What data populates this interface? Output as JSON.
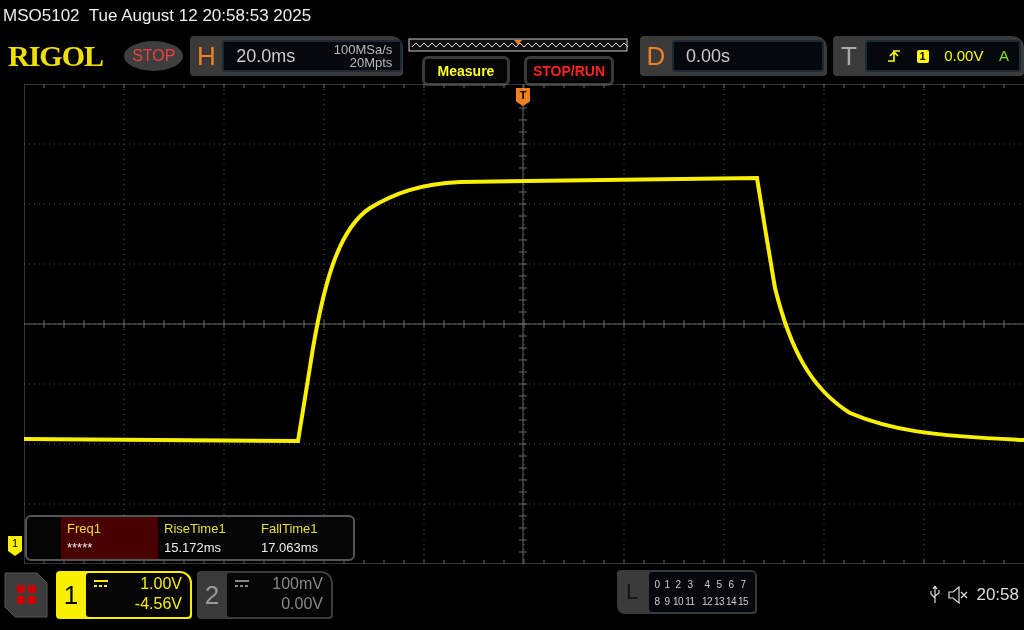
{
  "status_bar": {
    "title": "MSO5102  Tue August 12 20:58:53 2025"
  },
  "toolbar": {
    "logo": "RIGOL",
    "run_state": "STOP",
    "horizontal": {
      "label": "H",
      "timebase": "20.0ms",
      "sample_rate": "100MSa/s",
      "memory_depth": "20Mpts"
    },
    "buttons": [
      {
        "label": "Measure",
        "kind": "measure"
      },
      {
        "label": "STOP/RUN",
        "kind": "stop"
      }
    ],
    "delay": {
      "label": "D",
      "value": "0.00s"
    },
    "trigger": {
      "label": "T",
      "source": "1",
      "level": "0.00V",
      "mode": "A"
    }
  },
  "display": {
    "trigger_marker": "T",
    "channel_marker": "1",
    "measurements": [
      {
        "name": "Freq1",
        "value": "*****",
        "selected": true
      },
      {
        "name": "RiseTime1",
        "value": "15.172ms",
        "selected": false
      },
      {
        "name": "FallTime1",
        "value": "17.063ms",
        "selected": false
      }
    ]
  },
  "bottom_bar": {
    "channels": [
      {
        "number": "1",
        "scale": "1.00V",
        "offset": "-4.56V",
        "selected": true
      },
      {
        "number": "2",
        "scale": "100mV",
        "offset": "0.00V",
        "selected": false
      }
    ],
    "logic": {
      "label": "L",
      "rows": [
        [
          "0",
          "1",
          "2",
          "3",
          "4",
          "5",
          "6",
          "7"
        ],
        [
          "8",
          "9",
          "10",
          "11",
          "12",
          "13",
          "14",
          "15"
        ]
      ]
    },
    "time": "20:58"
  }
}
